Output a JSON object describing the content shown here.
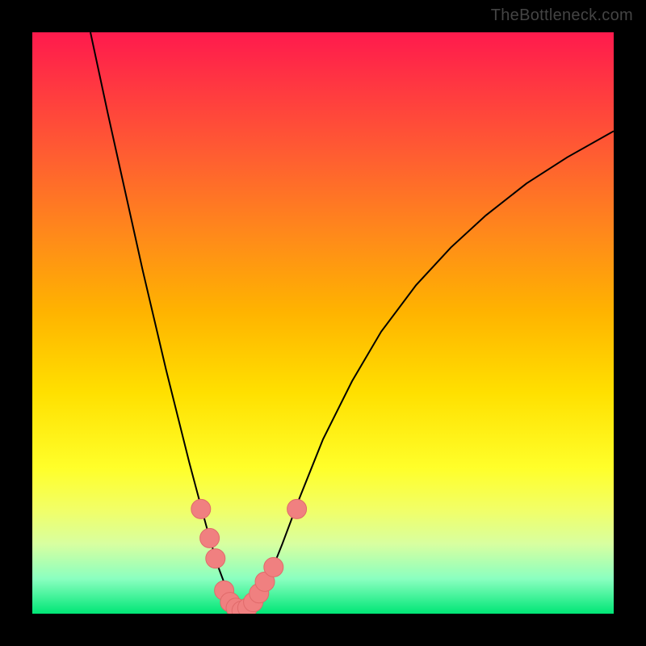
{
  "watermark": "TheBottleneck.com",
  "colors": {
    "curve_stroke": "#000000",
    "marker_fill": "#f08080",
    "marker_stroke": "#e06a6a",
    "background_top": "#ff1a4d",
    "background_bottom": "#00e676"
  },
  "chart_data": {
    "type": "line",
    "title": "",
    "xlabel": "",
    "ylabel": "",
    "xlim": [
      0,
      100
    ],
    "ylim": [
      0,
      100
    ],
    "series": [
      {
        "name": "curve",
        "x": [
          10.0,
          11.5,
          13.0,
          15.0,
          17.0,
          19.0,
          21.0,
          23.0,
          25.0,
          27.0,
          29.0,
          30.5,
          32.0,
          33.5,
          34.8,
          36.0,
          37.5,
          39.0,
          41.0,
          43.0,
          46.0,
          50.0,
          55.0,
          60.0,
          66.0,
          72.0,
          78.0,
          85.0,
          92.0,
          100.0
        ],
        "y": [
          100.0,
          93.0,
          86.0,
          77.0,
          68.0,
          59.0,
          50.5,
          42.0,
          34.0,
          26.0,
          18.5,
          13.0,
          8.0,
          4.0,
          1.5,
          0.5,
          1.0,
          3.0,
          7.0,
          12.0,
          20.0,
          30.0,
          40.0,
          48.5,
          56.5,
          63.0,
          68.5,
          74.0,
          78.5,
          83.0
        ]
      }
    ],
    "markers": [
      {
        "x": 29.0,
        "y": 18.0
      },
      {
        "x": 30.5,
        "y": 13.0
      },
      {
        "x": 31.5,
        "y": 9.5
      },
      {
        "x": 33.0,
        "y": 4.0
      },
      {
        "x": 34.0,
        "y": 2.0
      },
      {
        "x": 35.0,
        "y": 1.0
      },
      {
        "x": 36.0,
        "y": 0.5
      },
      {
        "x": 37.0,
        "y": 1.0
      },
      {
        "x": 38.0,
        "y": 2.0
      },
      {
        "x": 39.0,
        "y": 3.5
      },
      {
        "x": 40.0,
        "y": 5.5
      },
      {
        "x": 41.5,
        "y": 8.0
      },
      {
        "x": 45.5,
        "y": 18.0
      }
    ],
    "marker_radius": 12
  }
}
